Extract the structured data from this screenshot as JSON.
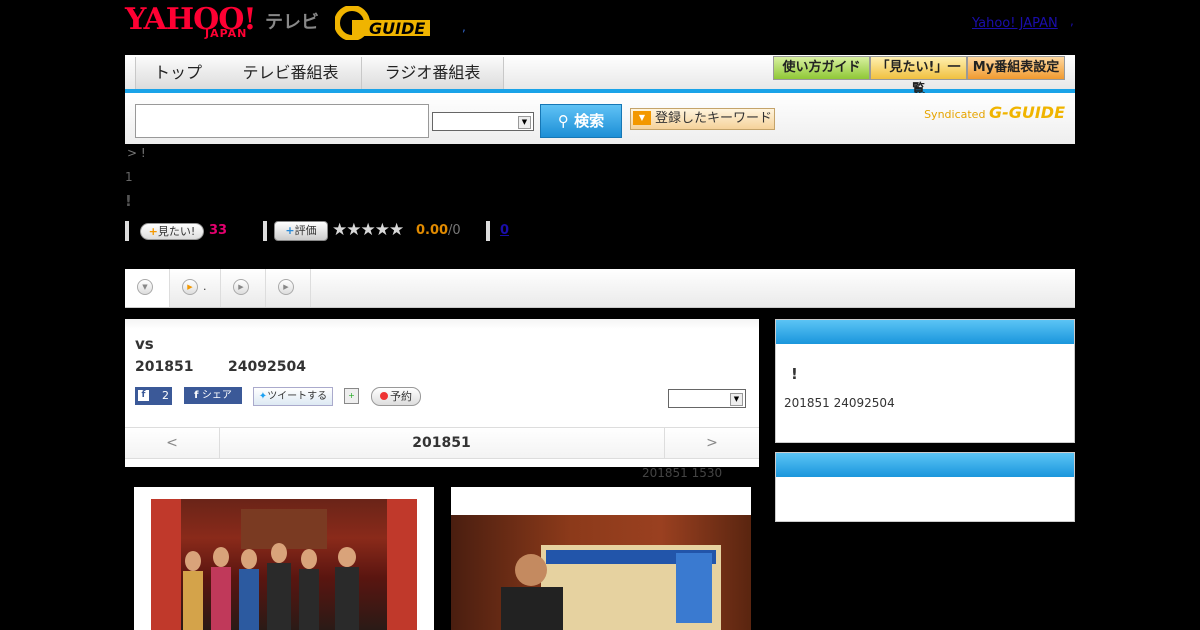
{
  "header": {
    "logo_yahoo": "YAHOO!",
    "logo_japan": "JAPAN",
    "logo_tv": "テレビ",
    "logo_gguide": "G-GUIDE",
    "dot": ",",
    "yahoo_link": "Yahoo! JAPAN",
    "yahoo_link_dot": ","
  },
  "nav": {
    "tabs": [
      "トップ",
      "テレビ番組表",
      "ラジオ番組表"
    ],
    "buttons": [
      "使い方ガイド",
      "「見たい!」一覧",
      "My番組表設定"
    ]
  },
  "search": {
    "placeholder": "",
    "button_label": "検索",
    "keyword_button": "登録したキーワード",
    "syndicated": "Syndicated",
    "syndicated_brand": "G-GUIDE"
  },
  "program": {
    "breadcrumb": "> !",
    "line_one": "1",
    "title": "!",
    "mitai_label": "見たい!",
    "mitai_count": "33",
    "hyouka_label": "評価",
    "stars": "★★★★★",
    "rating": "0.00",
    "rating_total": "/0",
    "comment_count": "0"
  },
  "tabs_bar": {
    "tabs": [
      {
        "icon": "chevron-down-icon",
        "label": ""
      },
      {
        "icon": "play-icon",
        "label": "."
      },
      {
        "icon": "play-icon",
        "label": ""
      },
      {
        "icon": "play-icon",
        "label": ""
      }
    ]
  },
  "main": {
    "title": "vs",
    "date": "201851",
    "sub": "24092504",
    "fb_like_count": "2",
    "fb_share": "シェア",
    "tweet": "ツイートする",
    "reserve": "予約",
    "pager_prev": "<",
    "pager_date": "201851",
    "pager_next": ">",
    "update_note": "201851  1530"
  },
  "side": {
    "box1_bang": "!",
    "box1_date": "201851  24092504"
  },
  "colors": {
    "accent_blue": "#1aa3e8",
    "yahoo_red": "#ff0033",
    "mitai_pink": "#e4006f",
    "rating_orange": "#e08a00"
  }
}
